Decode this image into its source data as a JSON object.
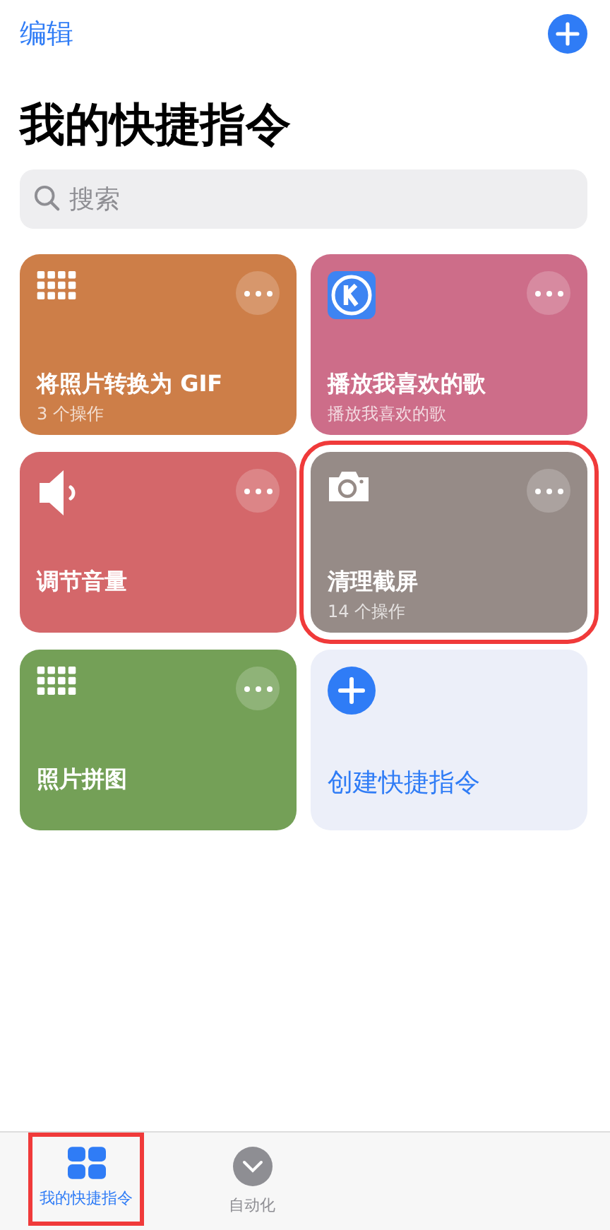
{
  "nav": {
    "edit": "编辑"
  },
  "title": "我的快捷指令",
  "search": {
    "placeholder": "搜索"
  },
  "cards": [
    {
      "kind": "grid",
      "title": "将照片转换为 GIF",
      "subtitle": "3 个操作",
      "color": "#cd7e48",
      "highlighted": false
    },
    {
      "kind": "app",
      "title": "播放我喜欢的歌",
      "subtitle": "播放我喜欢的歌",
      "color": "#cd6d89",
      "highlighted": false
    },
    {
      "kind": "speaker",
      "title": "调节音量",
      "color": "#d4676a",
      "highlighted": false
    },
    {
      "kind": "camera",
      "title": "清理截屏",
      "subtitle": "14 个操作",
      "color": "#968b87",
      "highlighted": true
    },
    {
      "kind": "grid",
      "title": "照片拼图",
      "color": "#74a057",
      "highlighted": false
    },
    {
      "kind": "create",
      "title": "创建快捷指令",
      "highlighted": false
    }
  ],
  "tabs": [
    {
      "kind": "grid",
      "label": "我的快捷指令",
      "selected": true,
      "highlighted": true
    },
    {
      "kind": "check",
      "label": "自动化",
      "selected": false,
      "highlighted": false
    }
  ]
}
